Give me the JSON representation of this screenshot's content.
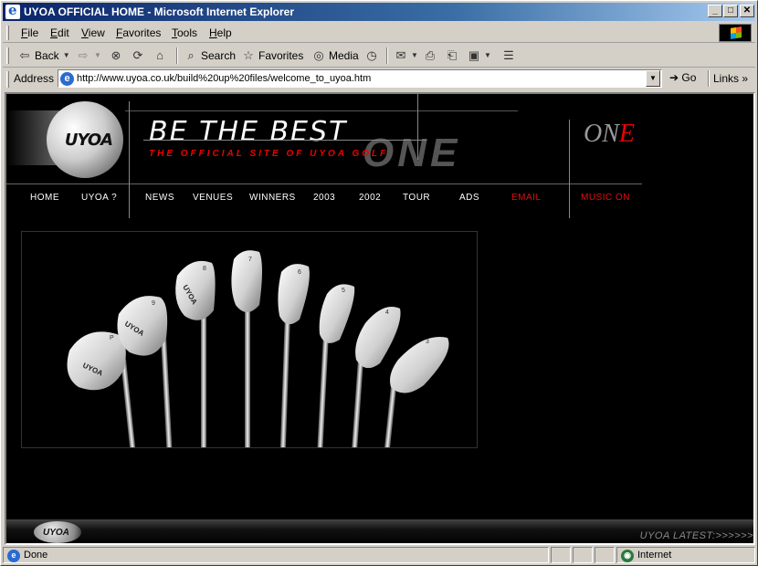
{
  "window": {
    "title": "UYOA OFFICIAL HOME - Microsoft Internet Explorer",
    "controls": {
      "minimize": "_",
      "maximize": "□",
      "close": "✕"
    }
  },
  "menu": [
    "File",
    "Edit",
    "View",
    "Favorites",
    "Tools",
    "Help"
  ],
  "toolbar": {
    "back": "Back",
    "search": "Search",
    "favorites": "Favorites",
    "media": "Media"
  },
  "address": {
    "label": "Address",
    "url": "http://www.uyoa.co.uk/build%20up%20files/welcome_to_uyoa.htm",
    "go": "Go",
    "links": "Links"
  },
  "page": {
    "logo": "UYOA",
    "tagline": "BE THE BEST",
    "subtitle": "THE OFFICIAL SITE OF UYOA GOLF",
    "one_graphic": "ONE",
    "one_corner_prefix": "ON",
    "one_corner_suffix": "E",
    "nav": [
      {
        "label": "HOME",
        "highlight": false
      },
      {
        "label": "UYOA ?",
        "highlight": false
      },
      {
        "label": "NEWS",
        "highlight": false
      },
      {
        "label": "VENUES",
        "highlight": false
      },
      {
        "label": "WINNERS",
        "highlight": false
      },
      {
        "label": "2003",
        "highlight": false
      },
      {
        "label": "2002",
        "highlight": false
      },
      {
        "label": "TOUR",
        "highlight": false
      },
      {
        "label": "ADS",
        "highlight": false
      },
      {
        "label": "EMAIL",
        "highlight": true
      },
      {
        "label": "MUSIC ON",
        "highlight": true
      }
    ],
    "club_brand": "UYOA",
    "club_numbers": [
      "P",
      "9",
      "8",
      "7",
      "6",
      "5",
      "4",
      "3"
    ],
    "footer_logo": "UYOA",
    "latest": "UYOA LATEST:>>>>>>"
  },
  "status": {
    "text": "Done",
    "zone": "Internet"
  },
  "colors": {
    "accent_red": "#e01010",
    "titlebar_start": "#0a246a",
    "titlebar_end": "#a6caf0",
    "chrome": "#d4d0c8"
  }
}
